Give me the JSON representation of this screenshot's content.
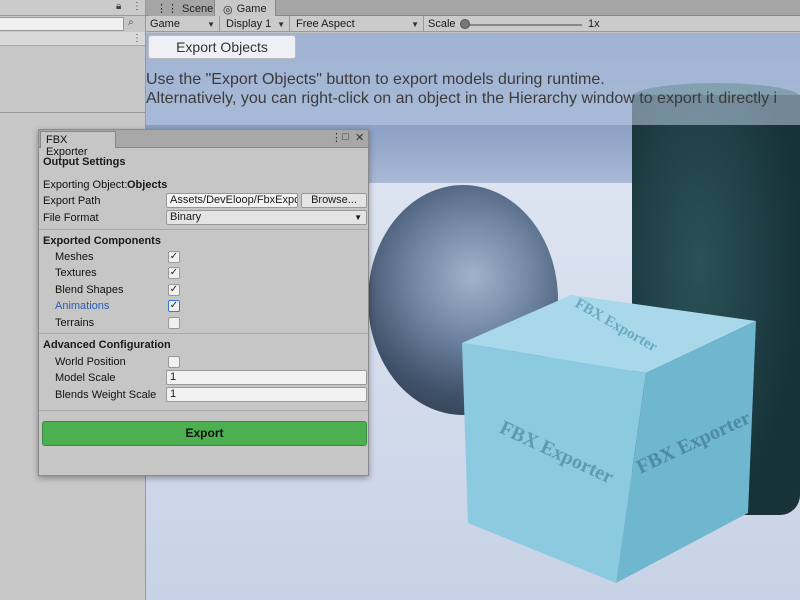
{
  "left_panel": {
    "lock_icon": "lock-icon",
    "more_icon": "kebab-icon",
    "search_icon": "search-icon"
  },
  "tabs": [
    {
      "label": "Scene",
      "icon": "scene-grid-icon"
    },
    {
      "label": "Game",
      "icon": "gamepad-icon"
    }
  ],
  "game_toolbar": {
    "display_mode": "Game",
    "display": "Display 1",
    "aspect": "Free Aspect",
    "scale_label": "Scale",
    "scale_value": "1x"
  },
  "viewport": {
    "export_objects_button": "Export Objects",
    "info_line_1": "Use the \"Export Objects\" button to export models during runtime.",
    "info_line_2": "Alternatively, you can right-click on an object in the Hierarchy window to export it directly i",
    "cube_text": "FBX Exporter"
  },
  "fbx_window": {
    "title": "FBX Exporter",
    "output_settings": "Output Settings",
    "exporting_object_label": "Exporting Object:",
    "exporting_object_value": "Objects",
    "export_path_label": "Export Path",
    "export_path_value": "Assets/DevEloop/FbxExporter/Export",
    "browse_label": "Browse...",
    "file_format_label": "File Format",
    "file_format_value": "Binary",
    "exported_components": "Exported Components",
    "components": [
      {
        "label": "Meshes",
        "checked": true
      },
      {
        "label": "Textures",
        "checked": true
      },
      {
        "label": "Blend Shapes",
        "checked": true
      },
      {
        "label": "Animations",
        "checked": true
      },
      {
        "label": "Terrains",
        "checked": false
      }
    ],
    "advanced_configuration": "Advanced Configuration",
    "world_position_label": "World Position",
    "world_position_checked": false,
    "model_scale_label": "Model Scale",
    "model_scale_value": "1",
    "blends_weight_scale_label": "Blends Weight Scale",
    "blends_weight_scale_value": "1",
    "export_button": "Export"
  }
}
